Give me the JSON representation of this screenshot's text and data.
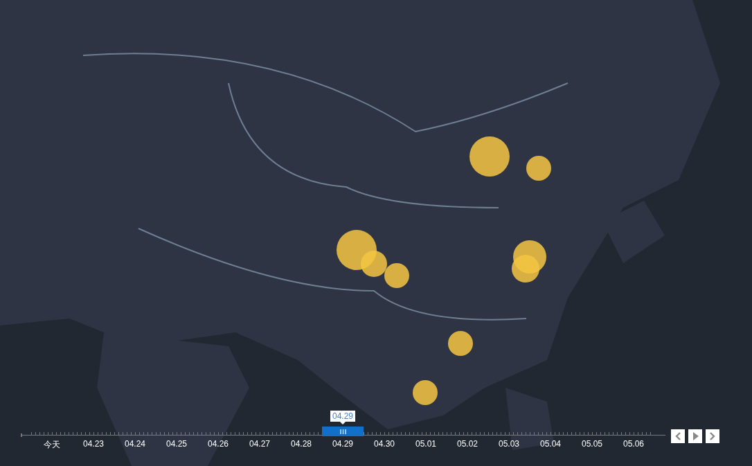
{
  "timeline": {
    "tooltip": "04.29",
    "dates": [
      {
        "label": "今天",
        "selected": false
      },
      {
        "label": "04.23",
        "selected": false
      },
      {
        "label": "04.24",
        "selected": false
      },
      {
        "label": "04.25",
        "selected": false
      },
      {
        "label": "04.26",
        "selected": false
      },
      {
        "label": "04.27",
        "selected": false
      },
      {
        "label": "04.28",
        "selected": false
      },
      {
        "label": "04.29",
        "selected": true
      },
      {
        "label": "04.30",
        "selected": false
      },
      {
        "label": "05.01",
        "selected": false
      },
      {
        "label": "05.02",
        "selected": false
      },
      {
        "label": "05.03",
        "selected": false
      },
      {
        "label": "05.04",
        "selected": false
      },
      {
        "label": "05.05",
        "selected": false
      },
      {
        "label": "05.06",
        "selected": false
      }
    ]
  },
  "controls": [
    {
      "kind": "prev"
    },
    {
      "kind": "play"
    },
    {
      "kind": "next"
    }
  ]
}
